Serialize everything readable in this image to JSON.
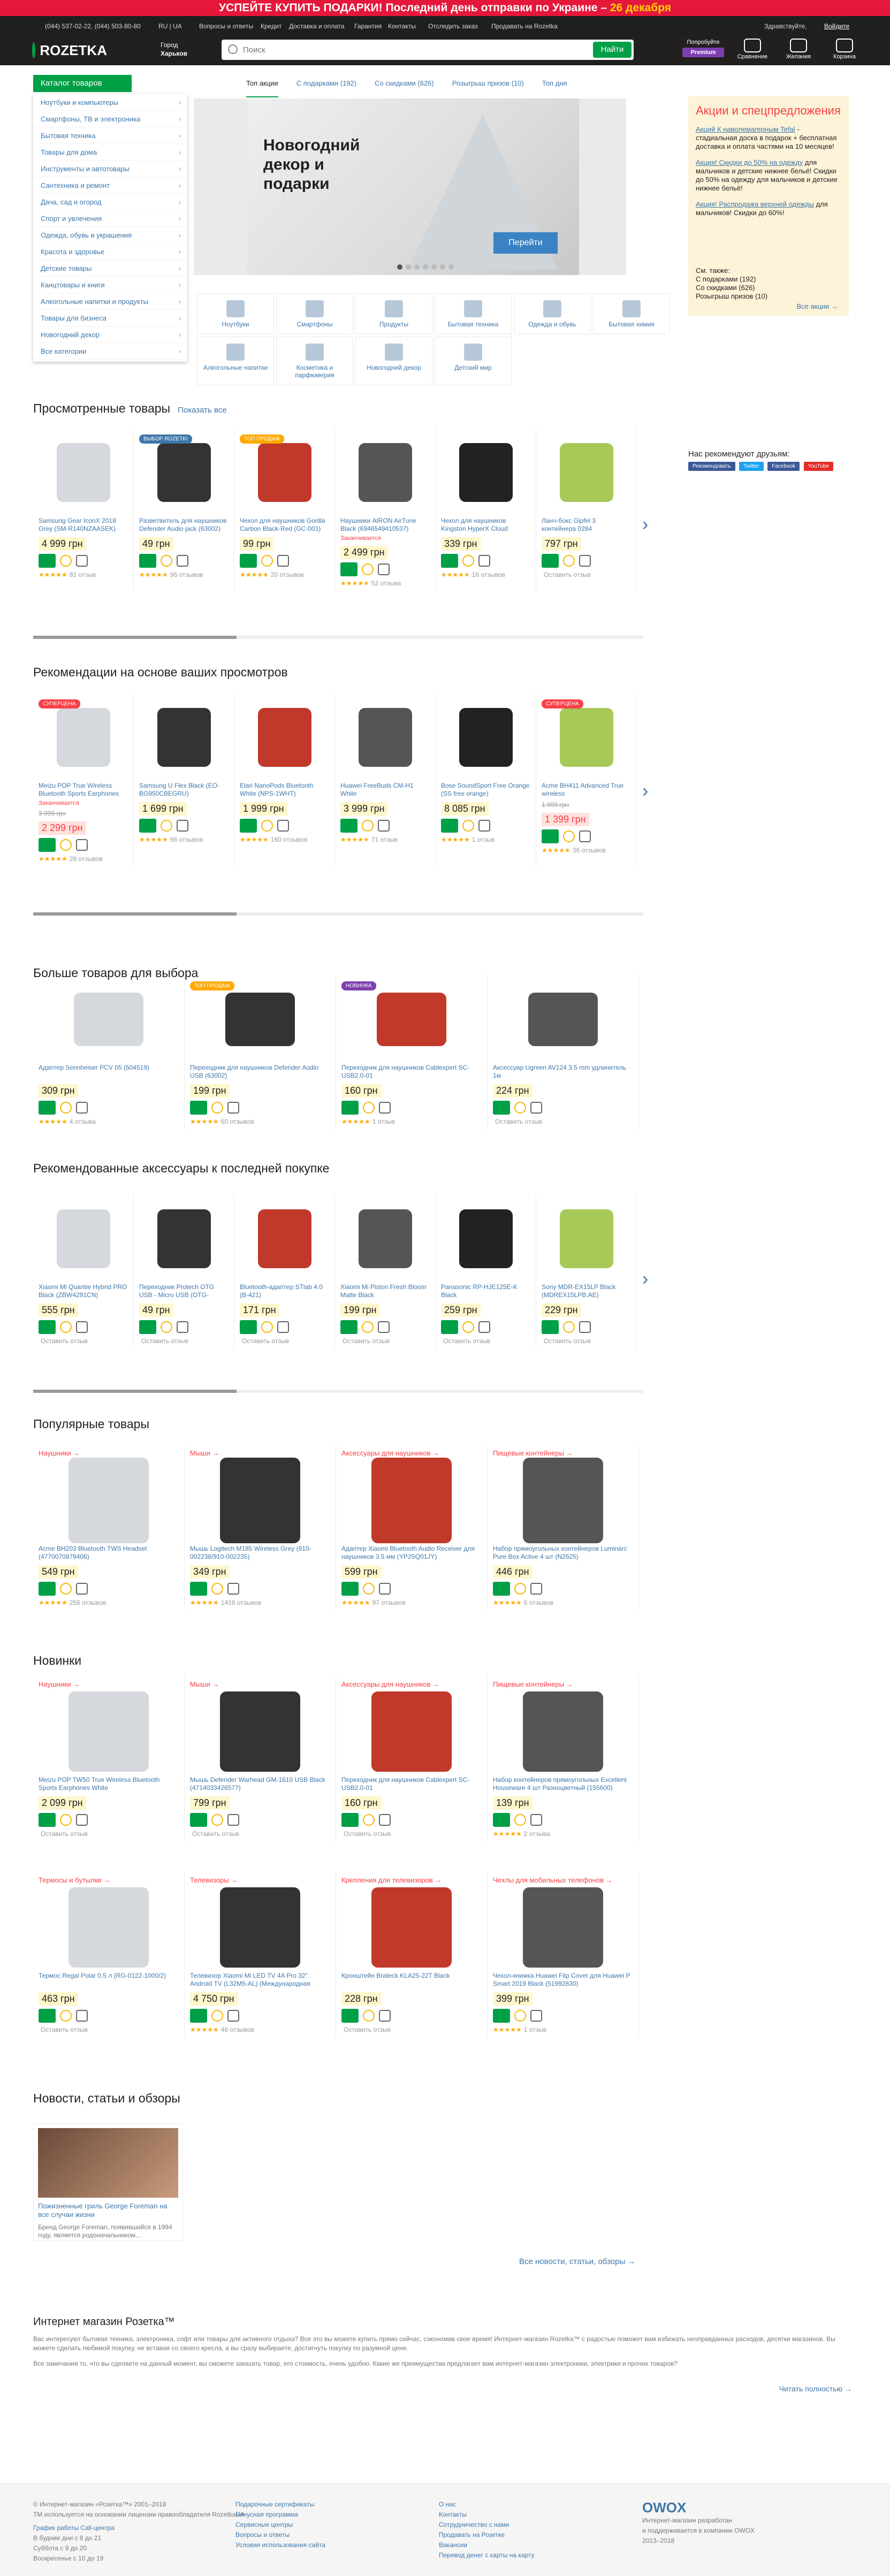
{
  "promo": {
    "text_pre": "УСПЕЙТЕ КУПИТЬ ПОДАРКИ! Последний день отправки по Украине – ",
    "text_hl": "26 декабря"
  },
  "topbar": {
    "phone": "(044) 537-02-22, (044) 503-80-80",
    "lang": "RU | UA",
    "links": [
      "Вопросы и ответы",
      "Кредит",
      "Доставка и оплата",
      "Гарантия",
      "Контакты",
      "Отследить заказ",
      "Продавать на Rozetka"
    ],
    "greeting": "Здравствуйте,",
    "login": "Войдите"
  },
  "header": {
    "logo": "ROZETKA",
    "city_label": "Город",
    "city": "Харьков",
    "premium_top": "Попробуйте",
    "premium": "Premium",
    "icons": [
      "Сравнение",
      "Желания",
      "Корзина"
    ]
  },
  "search": {
    "placeholder": "Поиск",
    "button": "Найти"
  },
  "catalog": {
    "button": "Каталог товаров",
    "items": [
      "Ноутбуки и компьютеры",
      "Смартфоны, ТВ и электроника",
      "Бытовая техника",
      "Товары для дома",
      "Инструменты и автотовары",
      "Сантехника и ремонт",
      "Дача, сад и огород",
      "Спорт и увлечения",
      "Одежда, обувь и украшения",
      "Красота и здоровье",
      "Детские товары",
      "Канцтовары и книги",
      "Алкогольные напитки и продукты",
      "Товары для бизнеса",
      "Новогодний декор",
      "Все категории"
    ]
  },
  "promo_tabs": [
    "Топ акции",
    "С подарками (192)",
    "Со скидками (626)",
    "Розыгрыш призов (10)",
    "Топ дня"
  ],
  "banner": {
    "title": "Новогодний декор и подарки",
    "button": "Перейти"
  },
  "sidebox": {
    "title": "Акции и спецпредложения",
    "items": [
      {
        "link": "Акций К наволемагерным Tefal",
        "text": "- стадиальная доска в подарок + бесплатная доставка и оплата частями на 10 месяцев!"
      },
      {
        "link": "Акция! Скидки до 50% на одежду",
        "text": "для мальчиков и детские нижнее бельё! Скидки до 50% на одежду для мальчиков и детские нижнее бельё!"
      },
      {
        "link": "Акция! Распродажа верхней одежды",
        "text": "для мальчиков! Скидки до 60%!"
      }
    ],
    "see_also": "См. также:",
    "links": [
      "С подарками (192)",
      "Со скидками (626)",
      "Розыгрыш призов (10)"
    ],
    "all": "Все акции →"
  },
  "categories": [
    "Ноутбуки",
    "Смартфоны",
    "Продукты",
    "Бытовая техника",
    "Одежда и обувь",
    "Бытовая химия",
    "Алкогольные напитки",
    "Косметика и парфюмерия",
    "Новогодний декор",
    "Детский мир"
  ],
  "sections": {
    "viewed": {
      "title": "Просмотренные товары",
      "link": "Показать все"
    },
    "recs": {
      "title": "Рекомендации на основе ваших просмотров"
    },
    "more": {
      "title": "Больше товаров для выбора"
    },
    "acc": {
      "title": "Рекомендованные аксессуары к последней покупке"
    },
    "popular": {
      "title": "Популярные товары"
    },
    "new": {
      "title": "Новинки"
    },
    "news": {
      "title": "Новости, статьи и обзоры",
      "all": "Все новости, статьи, обзоры →"
    }
  },
  "social": {
    "title": "Нас рекомендуют друзьям:",
    "items": [
      "Рекомендовать",
      "Twitter",
      "Facebook",
      "YouTube"
    ]
  },
  "viewed_items": [
    {
      "t": "Samsung Gear IconX 2018 Grey (SM-R140NZAASEK)",
      "p": "4 999 грн",
      "rev": "81 отзыв",
      "badge": "",
      "s": ""
    },
    {
      "t": "Разветвитель для наушников Defender Audio jack (63002)",
      "p": "49 грн",
      "rev": "96 отзывов",
      "badge": "ВЫБОР ROZETKI",
      "s": ""
    },
    {
      "t": "Чехол для наушников Gorilla Carbon Black-Red (GC-001)",
      "p": "99 грн",
      "rev": "20 отзывов",
      "badge": "ТОП ПРОДАЖ",
      "s": ""
    },
    {
      "t": "Наушники AIRON AirTune Black (6946549410537)",
      "p": "2 499 грн",
      "rev": "52 отзыва",
      "badge": "",
      "s": "Заканчивается"
    },
    {
      "t": "Чехол для наушников Kingston HyperX Cloud Headset Carrying Case",
      "p": "339 грн",
      "rev": "16 отзывов",
      "badge": "",
      "s": ""
    },
    {
      "t": "Ланч-бокс Gipfel 3 контейнера 0284",
      "p": "797 грн",
      "rev": "Оставить отзыв",
      "badge": "",
      "s": ""
    }
  ],
  "rec_items": [
    {
      "t": "Meizu POP True Wireless Bluetooth Sports Earphones White (TW50S)",
      "p": "2 299 грн",
      "old": "3 099 грн",
      "rev": "28 отзывов",
      "badge": "СУПЕРЦЕНА",
      "s": "Заканчивается"
    },
    {
      "t": "Samsung U Flex Black (EO-BG950CBEGRU)",
      "p": "1 699 грн",
      "old": "",
      "rev": "96 отзывов",
      "badge": "",
      "s": ""
    },
    {
      "t": "Elari NanoPods Bluetooth White (NPS-1WHT)",
      "p": "1 999 грн",
      "old": "",
      "rev": "160 отзывов",
      "badge": "",
      "s": ""
    },
    {
      "t": "Huawei FreeBuds CM-H1 White",
      "p": "3 999 грн",
      "old": "",
      "rev": "71 отзыв",
      "badge": "",
      "s": ""
    },
    {
      "t": "Bose SoundSport Free Orange (SS free orange)",
      "p": "8 085 грн",
      "old": "",
      "rev": "1 отзыв",
      "badge": "",
      "s": ""
    },
    {
      "t": "Acme BH411 Advanced True wireless",
      "p": "1 399 грн",
      "old": "1 999 грн",
      "rev": "36 отзывов",
      "badge": "СУПЕРЦЕНА",
      "s": ""
    }
  ],
  "more_items": [
    {
      "t": "Адаптер Sennheiser PCV 05 (504519)",
      "p": "309 грн",
      "rev": "4 отзыва",
      "badge": ""
    },
    {
      "t": "Переходник для наушников Defender Audio USB (63002)",
      "p": "199 грн",
      "rev": "60 отзывов",
      "badge": "ТОП ПРОДАЖ"
    },
    {
      "t": "Переходник для наушников Cablexpert SC-USB2.0-01",
      "p": "160 грн",
      "rev": "1 отзыв",
      "badge": "НОВИНКА"
    },
    {
      "t": "Аксессуар Ugreen AV124 3.5 mm удлинитель 1м",
      "p": "224 грн",
      "rev": "Оставить отзыв",
      "badge": ""
    }
  ],
  "acc_items": [
    {
      "t": "Xiaomi Mi Quantie Hybrid PRO Black (ZBW4291CN)",
      "p": "555 грн",
      "rev": "Оставить отзыв"
    },
    {
      "t": "Переходник Protech OTG USB - Micro USB (OTG-MicroUSB)",
      "p": "49 грн",
      "rev": "Оставить отзыв"
    },
    {
      "t": "Bluetooth-адаптер STlab 4.0 (B-421)",
      "p": "171 грн",
      "rev": "Оставить отзыв"
    },
    {
      "t": "Xiaomi Mi Piston Fresh Bloom Matte Black",
      "p": "199 грн",
      "rev": "Оставить отзыв"
    },
    {
      "t": "Panasonic RP-HJE125E-K Black",
      "p": "259 грн",
      "rev": "Оставить отзыв"
    },
    {
      "t": "Sony MDR-EX15LP Black (MDREX15LPB.AE)",
      "p": "229 грн",
      "rev": "Оставить отзыв"
    }
  ],
  "popular_items": [
    {
      "cat": "Наушники →",
      "t": "Acme BH203 Bluetooth TWS Headset (4770070879406)",
      "p": "549 грн",
      "rev": "256 отзывов"
    },
    {
      "cat": "Мыши →",
      "t": "Мышь Logitech M185 Wireless Grey (910-002238/910-002235)",
      "p": "349 грн",
      "rev": "1416 отзывов"
    },
    {
      "cat": "Аксессуары для наушников →",
      "t": "Адаптер Xiaomi Bluetooth Audio Receiver для наушников 3.5 мм (YPJSQ01JY)",
      "p": "599 грн",
      "rev": "97 отзывов"
    },
    {
      "cat": "Пищевые контейнеры →",
      "t": "Набор прямоугольных контейнеров Luminarc Pure Box Active 4 шт (N2625)",
      "p": "446 грн",
      "rev": "6 отзывов"
    }
  ],
  "new_items": [
    {
      "cat": "Наушники →",
      "t": "Meizu POP TW50 True Wireless Bluetooth Sports Earphones White",
      "p": "2 099 грн",
      "rev": "Оставить отзыв"
    },
    {
      "cat": "Мыши →",
      "t": "Мышь Defender Warhead GM-1610 USB Black (4714033426577)",
      "p": "799 грн",
      "rev": "Оставить отзыв"
    },
    {
      "cat": "Аксессуары для наушников →",
      "t": "Переходник для наушников Cablexpert SC-USB2.0-01",
      "p": "160 грн",
      "rev": "Оставить отзыв"
    },
    {
      "cat": "Пищевые контейнеры →",
      "t": "Набор контейнеров прямоугольных Excellent Houseware 4 шт Разноцветный (155600)",
      "p": "139 грн",
      "rev": "2 отзыва"
    },
    {
      "cat": "Термосы и бутылки →",
      "t": "Термос Regal Polar 0.5 л (RG-0122-1000/2)",
      "p": "463 грн",
      "rev": "Оставить отзыв"
    },
    {
      "cat": "Телевизоры →",
      "t": "Телевизор Xiaomi Mi LED TV 4A Pro 32\" Android TV (L32M5-AL) (Международная версия)",
      "p": "4 750 грн",
      "rev": "46 отзывов"
    },
    {
      "cat": "Крепления для телевизоров →",
      "t": "Кронштейн Brateck KLA25-22T Black",
      "p": "228 грн",
      "rev": "Оставить отзыв"
    },
    {
      "cat": "Чехлы для мобильных телефонов →",
      "t": "Чехол-книжка Huawei Flip Cover для Huawei P Smart 2019 Black (51992830)",
      "p": "399 грн",
      "rev": "1 отзыв"
    }
  ],
  "news": {
    "t": "Пожизненные гриль George Foreman на все случаи жизни",
    "d": "Бренд George Foreman, появившийся в 1994 году, является родоначальником..."
  },
  "seo": {
    "title": "Интернет магазин Розетка™",
    "p1": "Вас интересуют бытовая техника, электроника, софт или товары для активного отдыха? Все это вы можете купить прямо сейчас, сэкономив свое время! Интернет-магазин Rozetka™ с радостью поможет вам избежать неоправданных расходов, десятки магазинов. Вы можете сделать любимой покупку, не вставая со своего кресла, а вы сразу выбираете, достигнуть покупку по разумной цене.",
    "p2": "Все замечания то, что вы сделаете на данный момент, вы сможете заказать товар, его стоимость, очень удобно. Какие же преимущества предлагает вам интернет-магазин электроники, электрики и прочих товаров?",
    "more": "Читать полностью →"
  },
  "footer": {
    "copy": [
      "© Интернет-магазин «Розетка™» 2001–2018",
      "ТМ используется на основании лицензии правообладателя RozetkaUA"
    ],
    "schedule": [
      "График работы Call-центра",
      "В будние дни с 8 до 21",
      "Суббота с 9 до 20",
      "Воскресенье с 10 до 19"
    ],
    "col2": [
      "Подарочные сертификаты",
      "Бонусная программа",
      "Сервисные центры",
      "Вопросы и ответы",
      "Условия использования сайта"
    ],
    "col3": [
      "О нас",
      "Контакты",
      "Сотрудничество с нами",
      "Продавать на Розетке",
      "Вакансии",
      "Перевод денег с карты на карту"
    ],
    "brand": "OWOX",
    "brand_text": [
      "Интернет-магазин разработан",
      "и поддерживается в компании OWOX",
      "2013–2018"
    ]
  },
  "colors": {
    "accent": "#00a046",
    "link": "#3e77aa",
    "promo": "#e5173a",
    "sale": "#f84147"
  }
}
